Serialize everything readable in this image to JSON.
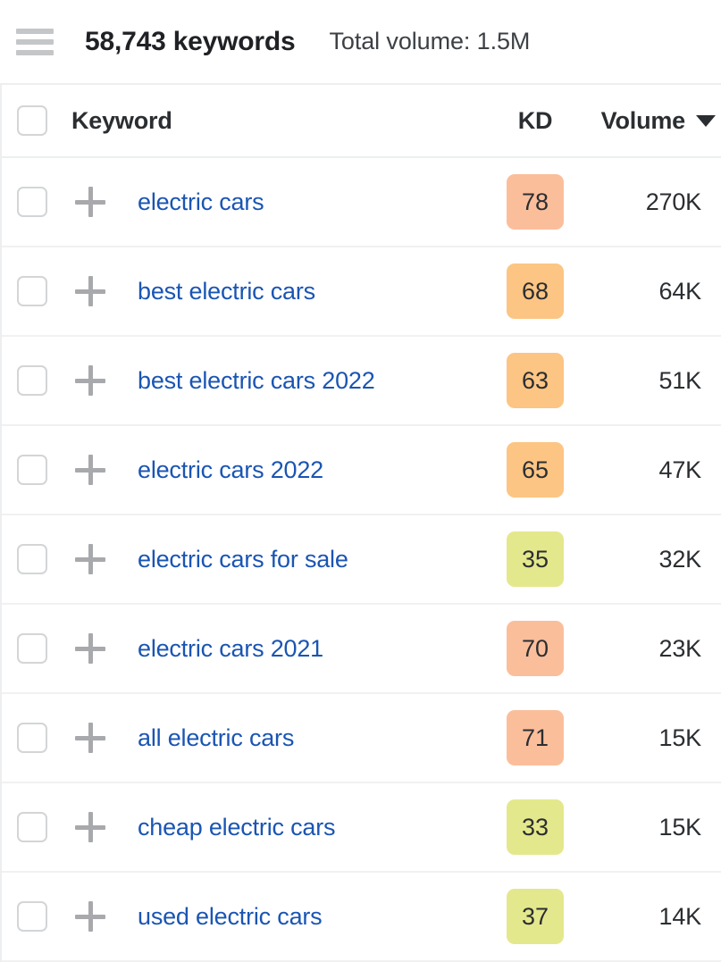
{
  "topbar": {
    "menu_icon": "hamburger-menu-icon",
    "title": "58,743 keywords",
    "subtitle": "Total volume: 1.5M"
  },
  "table": {
    "columns": {
      "keyword": "Keyword",
      "kd": "KD",
      "volume": "Volume"
    },
    "sort": {
      "column": "Volume",
      "direction": "desc",
      "caret_icon": "caret-down-icon"
    },
    "select_all_checked": false,
    "rows": [
      {
        "keyword": "electric cars",
        "kd": "78",
        "kd_color": "#fbbe9b",
        "volume": "270K",
        "checked": false
      },
      {
        "keyword": "best electric cars",
        "kd": "68",
        "kd_color": "#fcc583",
        "volume": "64K",
        "checked": false
      },
      {
        "keyword": "best electric cars 2022",
        "kd": "63",
        "kd_color": "#fcc583",
        "volume": "51K",
        "checked": false
      },
      {
        "keyword": "electric cars 2022",
        "kd": "65",
        "kd_color": "#fcc583",
        "volume": "47K",
        "checked": false
      },
      {
        "keyword": "electric cars for sale",
        "kd": "35",
        "kd_color": "#e4e88c",
        "volume": "32K",
        "checked": false
      },
      {
        "keyword": "electric cars 2021",
        "kd": "70",
        "kd_color": "#fbbe9b",
        "volume": "23K",
        "checked": false
      },
      {
        "keyword": "all electric cars",
        "kd": "71",
        "kd_color": "#fbbe9b",
        "volume": "15K",
        "checked": false
      },
      {
        "keyword": "cheap electric cars",
        "kd": "33",
        "kd_color": "#e4e88c",
        "volume": "15K",
        "checked": false
      },
      {
        "keyword": "used electric cars",
        "kd": "37",
        "kd_color": "#e4e88c",
        "volume": "14K",
        "checked": false
      }
    ]
  },
  "colors": {
    "link": "#1a55b3",
    "text": "#2b2e31",
    "border": "#eceef0",
    "icon_gray": "#a7a9ac"
  }
}
